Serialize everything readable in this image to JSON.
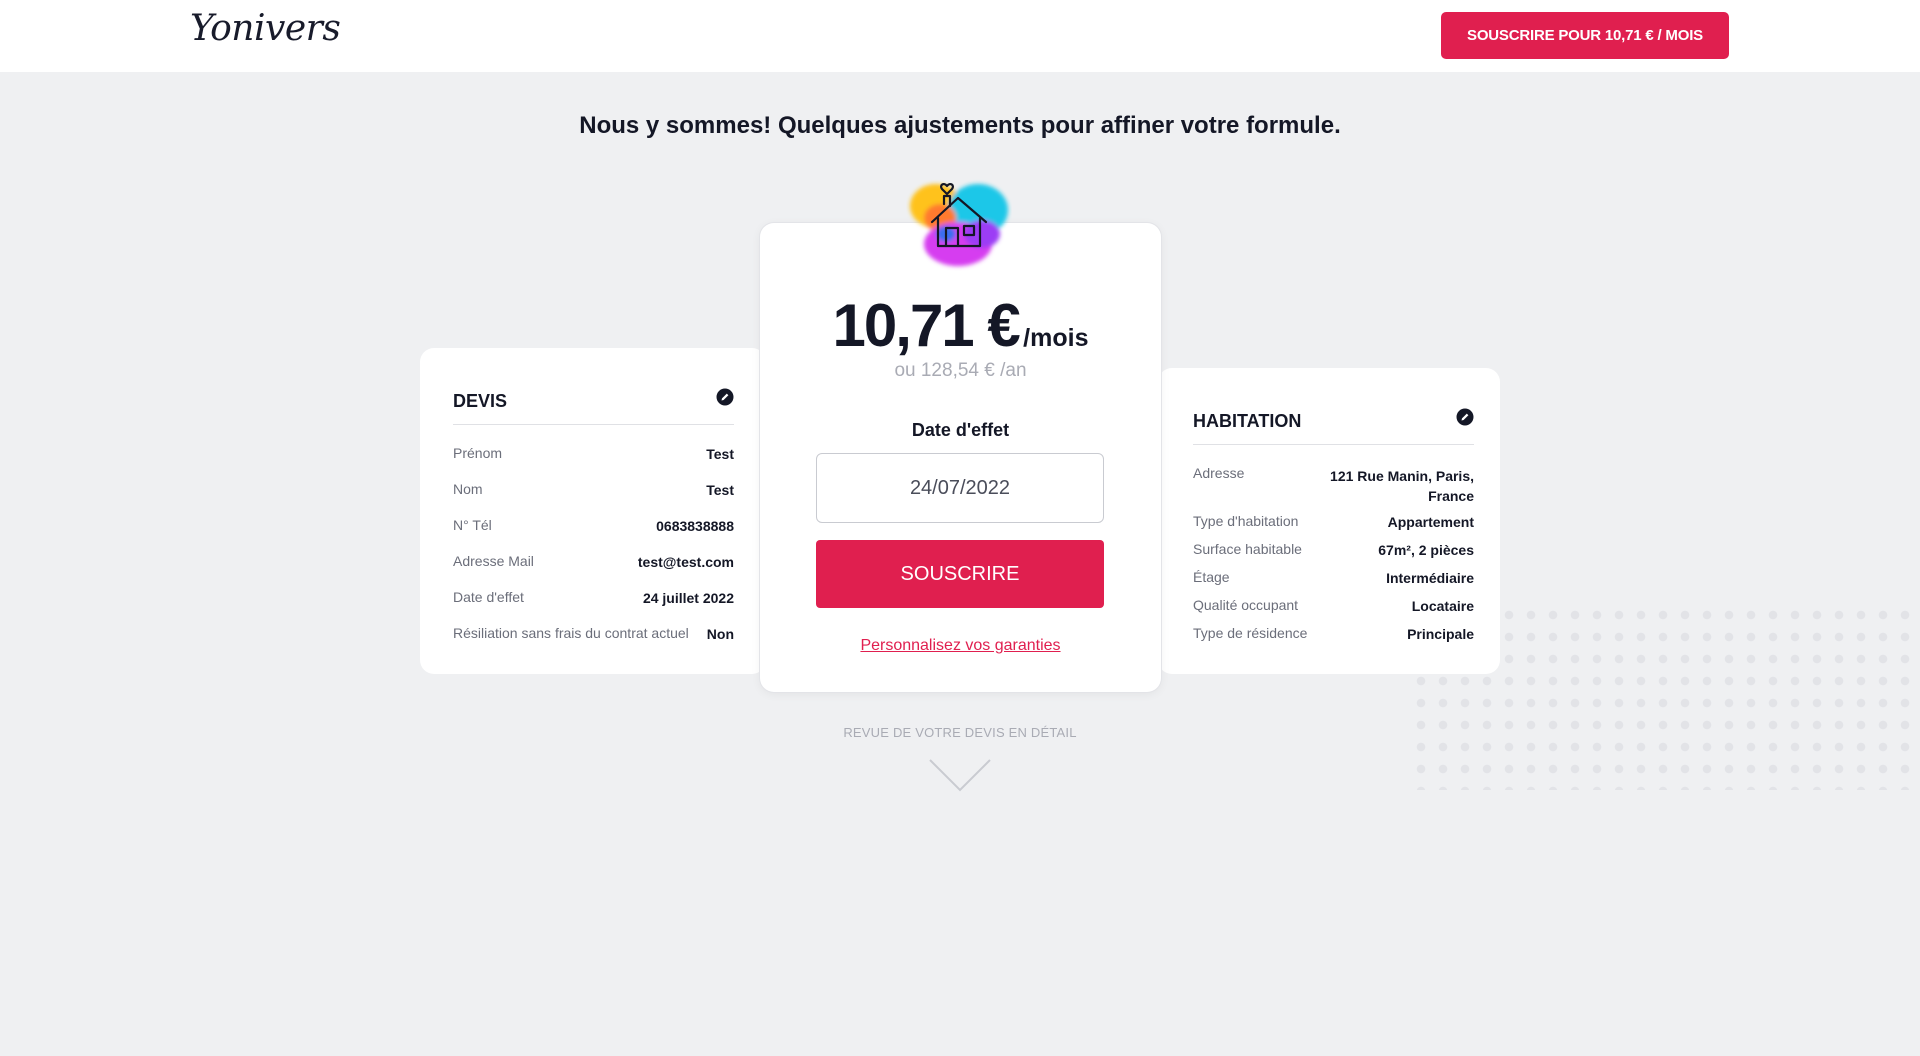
{
  "header": {
    "logo": "Yonivers",
    "cta_label": "SOUSCRIRE POUR 10,71 € / MOIS"
  },
  "headline": "Nous y sommes! Quelques ajustements pour affiner votre formule.",
  "devis": {
    "title": "DEVIS",
    "rows": [
      {
        "label": "Prénom",
        "value": "Test"
      },
      {
        "label": "Nom",
        "value": "Test"
      },
      {
        "label": "N° Tél",
        "value": "0683838888"
      },
      {
        "label": "Adresse Mail",
        "value": "test@test.com"
      },
      {
        "label": "Date d'effet",
        "value": "24 juillet 2022"
      },
      {
        "label": "Résiliation sans frais du contrat actuel",
        "value": "Non"
      }
    ]
  },
  "pricing": {
    "amount": "10,71 €",
    "per": "/mois",
    "yearly": "ou 128,54 € /an",
    "date_label": "Date d'effet",
    "date_value": "24/07/2022",
    "subscribe_label": "SOUSCRIRE",
    "customize_link": "Personnalisez vos garanties"
  },
  "habitation": {
    "title": "HABITATION",
    "address_label": "Adresse",
    "address_line1": "121 Rue Manin, Paris,",
    "address_line2": "France",
    "rows": [
      {
        "label": "Type d'habitation",
        "value": "Appartement"
      },
      {
        "label": "Surface habitable",
        "value": "67m², 2 pièces"
      },
      {
        "label": "Étage",
        "value": "Intermédiaire"
      },
      {
        "label": "Qualité occupant",
        "value": "Locataire"
      },
      {
        "label": "Type de résidence",
        "value": "Principale"
      }
    ]
  },
  "review": {
    "label": "REVUE DE VOTRE DEVIS EN DÉTAIL"
  },
  "colors": {
    "accent": "#e01f4f",
    "background": "#eff0f2",
    "text": "#141726"
  },
  "icons": {
    "edit": "pencil-circle-icon",
    "house": "house-heart-icon",
    "chevron": "chevron-down-icon"
  }
}
